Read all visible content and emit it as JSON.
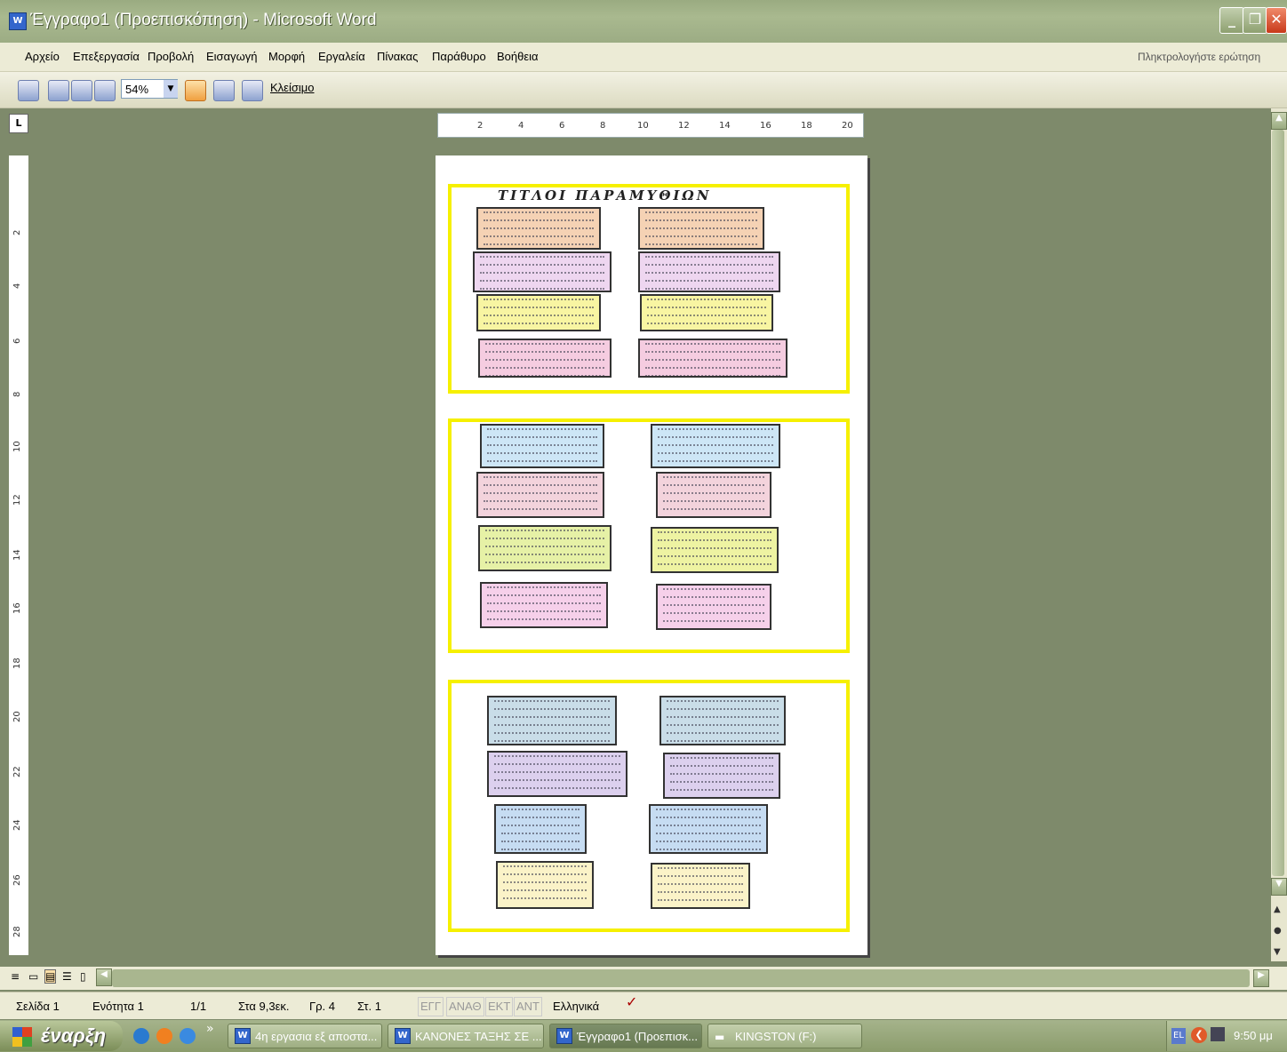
{
  "window": {
    "title": "Έγγραφο1 (Προεπισκόπηση) - Microsoft Word"
  },
  "menu": {
    "items": [
      "Αρχείο",
      "Επεξεργασία",
      "Προβολή",
      "Εισαγωγή",
      "Μορφή",
      "Εργαλεία",
      "Πίνακας",
      "Παράθυρο",
      "Βοήθεια"
    ],
    "ask": "Πληκτρολογήστε ερώτηση"
  },
  "toolbar": {
    "zoom": "54%",
    "close_label": "Κλείσιμο"
  },
  "ruler": {
    "h_ticks": [
      "2",
      "4",
      "6",
      "8",
      "10",
      "12",
      "14",
      "16",
      "18",
      "20"
    ],
    "v_ticks": [
      "2",
      "4",
      "6",
      "8",
      "10",
      "12",
      "14",
      "16",
      "18",
      "20",
      "22",
      "24",
      "26",
      "28"
    ],
    "tab_selector": "L"
  },
  "document": {
    "heading": "ΤΙΤΛΟΙ ΠΑΡΑΜΥΘΙΩΝ"
  },
  "status": {
    "page": "Σελίδα 1",
    "section": "Ενότητα 1",
    "pages": "1/1",
    "at": "Στα 9,3εκ.",
    "line": "Γρ. 4",
    "col": "Στ. 1",
    "modes": [
      "ΕΓΓ",
      "ΑΝΑΘ",
      "ΕΚΤ",
      "ΑΝΤ"
    ],
    "language": "Ελληνικά"
  },
  "taskbar": {
    "start": "έναρξη",
    "tasks": [
      "4η εργασια εξ αποστα...",
      "ΚΑΝΟΝΕΣ ΤΑΞΗΣ ΣΕ ...",
      "Έγγραφο1 (Προεπισκ...",
      "KINGSTON (F:)"
    ],
    "lang": "EL",
    "clock": "9:50 μμ"
  },
  "colors": {
    "frame": "#f6f000",
    "accent": "#3366cc"
  }
}
